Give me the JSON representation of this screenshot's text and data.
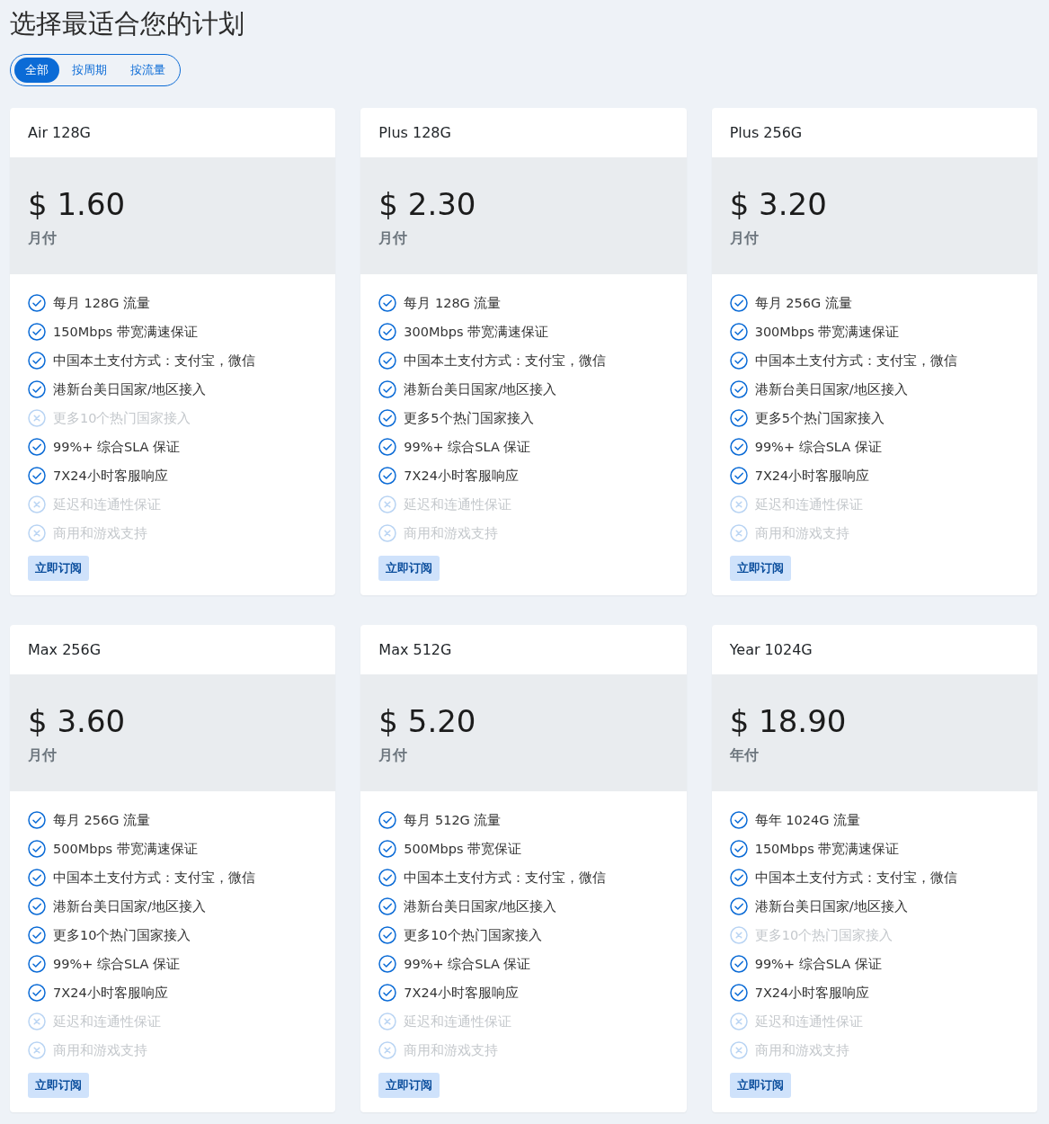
{
  "title": "选择最适合您的计划",
  "filters": [
    {
      "label": "全部",
      "selected": true
    },
    {
      "label": "按周期",
      "selected": false
    },
    {
      "label": "按流量",
      "selected": false
    }
  ],
  "plans": [
    {
      "name": "Air 128G",
      "price": "$ 1.60",
      "period": "月付",
      "button": "立即订阅",
      "features": [
        {
          "text": "每月 128G 流量",
          "included": true
        },
        {
          "text": "150Mbps 带宽满速保证",
          "included": true
        },
        {
          "text": "中国本土支付方式：支付宝，微信",
          "included": true
        },
        {
          "text": "港新台美日国家/地区接入",
          "included": true
        },
        {
          "text": "更多10个热门国家接入",
          "included": false
        },
        {
          "text": "99%+ 综合SLA 保证",
          "included": true
        },
        {
          "text": "7X24小时客服响应",
          "included": true
        },
        {
          "text": "延迟和连通性保证",
          "included": false
        },
        {
          "text": "商用和游戏支持",
          "included": false
        }
      ]
    },
    {
      "name": "Plus 128G",
      "price": "$ 2.30",
      "period": "月付",
      "button": "立即订阅",
      "features": [
        {
          "text": "每月 128G 流量",
          "included": true
        },
        {
          "text": "300Mbps 带宽满速保证",
          "included": true
        },
        {
          "text": "中国本土支付方式：支付宝，微信",
          "included": true
        },
        {
          "text": "港新台美日国家/地区接入",
          "included": true
        },
        {
          "text": "更多5个热门国家接入",
          "included": true
        },
        {
          "text": "99%+ 综合SLA 保证",
          "included": true
        },
        {
          "text": "7X24小时客服响应",
          "included": true
        },
        {
          "text": "延迟和连通性保证",
          "included": false
        },
        {
          "text": "商用和游戏支持",
          "included": false
        }
      ]
    },
    {
      "name": "Plus 256G",
      "price": "$ 3.20",
      "period": "月付",
      "button": "立即订阅",
      "features": [
        {
          "text": "每月 256G 流量",
          "included": true
        },
        {
          "text": "300Mbps 带宽满速保证",
          "included": true
        },
        {
          "text": "中国本土支付方式：支付宝，微信",
          "included": true
        },
        {
          "text": "港新台美日国家/地区接入",
          "included": true
        },
        {
          "text": "更多5个热门国家接入",
          "included": true
        },
        {
          "text": "99%+ 综合SLA 保证",
          "included": true
        },
        {
          "text": "7X24小时客服响应",
          "included": true
        },
        {
          "text": "延迟和连通性保证",
          "included": false
        },
        {
          "text": "商用和游戏支持",
          "included": false
        }
      ]
    },
    {
      "name": "Max 256G",
      "price": "$ 3.60",
      "period": "月付",
      "button": "立即订阅",
      "features": [
        {
          "text": "每月 256G 流量",
          "included": true
        },
        {
          "text": "500Mbps 带宽满速保证",
          "included": true
        },
        {
          "text": "中国本土支付方式：支付宝，微信",
          "included": true
        },
        {
          "text": "港新台美日国家/地区接入",
          "included": true
        },
        {
          "text": "更多10个热门国家接入",
          "included": true
        },
        {
          "text": "99%+ 综合SLA 保证",
          "included": true
        },
        {
          "text": "7X24小时客服响应",
          "included": true
        },
        {
          "text": "延迟和连通性保证",
          "included": false
        },
        {
          "text": "商用和游戏支持",
          "included": false
        }
      ]
    },
    {
      "name": "Max 512G",
      "price": "$ 5.20",
      "period": "月付",
      "button": "立即订阅",
      "features": [
        {
          "text": "每月 512G 流量",
          "included": true
        },
        {
          "text": "500Mbps 带宽保证",
          "included": true
        },
        {
          "text": "中国本土支付方式：支付宝，微信",
          "included": true
        },
        {
          "text": "港新台美日国家/地区接入",
          "included": true
        },
        {
          "text": "更多10个热门国家接入",
          "included": true
        },
        {
          "text": "99%+ 综合SLA 保证",
          "included": true
        },
        {
          "text": "7X24小时客服响应",
          "included": true
        },
        {
          "text": "延迟和连通性保证",
          "included": false
        },
        {
          "text": "商用和游戏支持",
          "included": false
        }
      ]
    },
    {
      "name": "Year 1024G",
      "price": "$ 18.90",
      "period": "年付",
      "button": "立即订阅",
      "features": [
        {
          "text": "每年 1024G 流量",
          "included": true
        },
        {
          "text": "150Mbps 带宽满速保证",
          "included": true
        },
        {
          "text": "中国本土支付方式：支付宝，微信",
          "included": true
        },
        {
          "text": "港新台美日国家/地区接入",
          "included": true
        },
        {
          "text": "更多10个热门国家接入",
          "included": false
        },
        {
          "text": "99%+ 综合SLA 保证",
          "included": true
        },
        {
          "text": "7X24小时客服响应",
          "included": true
        },
        {
          "text": "延迟和连通性保证",
          "included": false
        },
        {
          "text": "商用和游戏支持",
          "included": false
        }
      ]
    }
  ]
}
